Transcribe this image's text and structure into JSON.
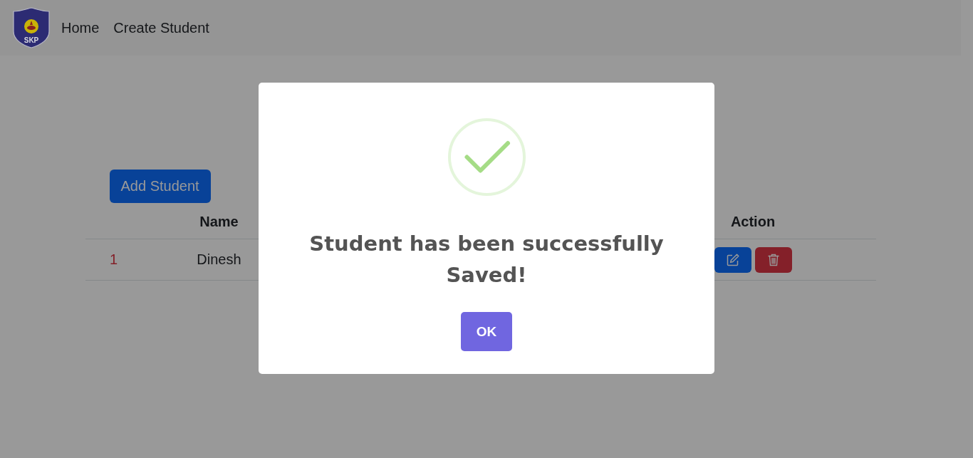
{
  "navbar": {
    "logo_text": "SKP",
    "links": [
      "Home",
      "Create Student"
    ]
  },
  "content": {
    "add_button": "Add Student",
    "table": {
      "header": {
        "name": "Name",
        "action": "Action"
      },
      "rows": [
        {
          "number": "1",
          "name": "Dinesh",
          "actions": [
            {
              "kind": "edit"
            },
            {
              "kind": "delete"
            }
          ]
        }
      ]
    }
  },
  "modal": {
    "icon": {
      "kind": "success"
    },
    "title": "Student has been successfully Saved!",
    "confirm_button": "OK"
  }
}
